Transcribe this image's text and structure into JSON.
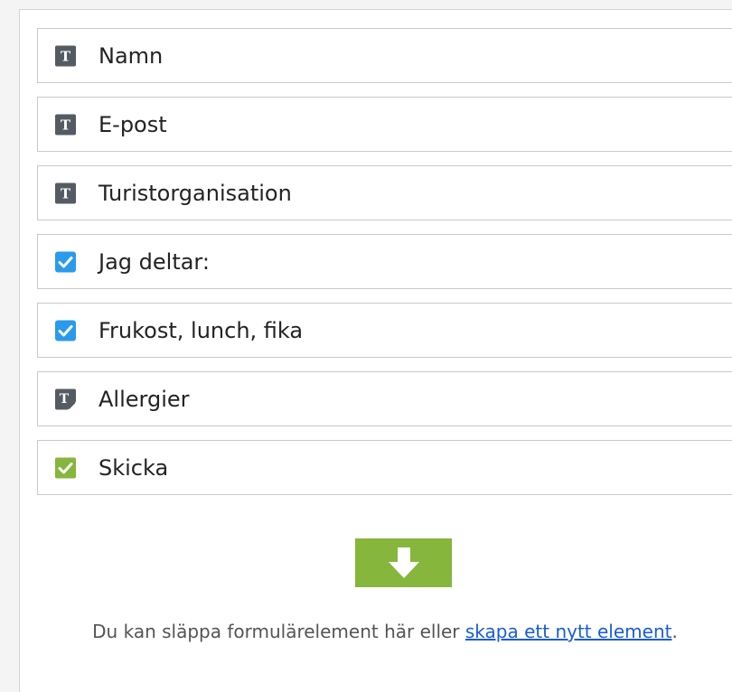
{
  "form_fields": [
    {
      "label": "Namn",
      "icon": "text-field-icon"
    },
    {
      "label": "E-post",
      "icon": "text-field-icon"
    },
    {
      "label": "Turistorganisation",
      "icon": "text-field-icon"
    },
    {
      "label": "Jag deltar:",
      "icon": "checkbox-icon"
    },
    {
      "label": "Frukost, lunch, fika",
      "icon": "checkbox-icon"
    },
    {
      "label": "Allergier",
      "icon": "textarea-icon"
    },
    {
      "label": "Skicka",
      "icon": "submit-icon"
    }
  ],
  "drop_zone": {
    "text_before": "Du kan släppa formulärelement här eller ",
    "link_label": "skapa ett nytt element",
    "text_after": ".",
    "icon": "arrow-down-icon"
  },
  "colors": {
    "text_icon_bg": "#555b62",
    "checkbox_blue": "#2a9bea",
    "submit_green": "#86b63c",
    "link": "#1a5cd6"
  }
}
